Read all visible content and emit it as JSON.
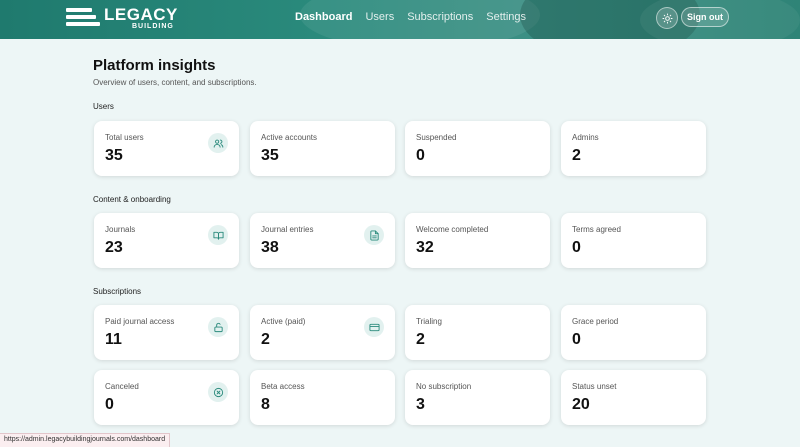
{
  "brand": {
    "name": "LEGACY",
    "sub": "BUILDING"
  },
  "nav": [
    {
      "label": "Dashboard",
      "active": true
    },
    {
      "label": "Users",
      "active": false
    },
    {
      "label": "Subscriptions",
      "active": false
    },
    {
      "label": "Settings",
      "active": false
    }
  ],
  "header": {
    "theme_icon": "sun-icon",
    "signout_label": "Sign out"
  },
  "page": {
    "title": "Platform insights",
    "subtitle": "Overview of users, content, and subscriptions."
  },
  "sections": {
    "users": {
      "label": "Users",
      "cards": [
        {
          "label": "Total users",
          "value": "35",
          "icon": "users-icon"
        },
        {
          "label": "Active accounts",
          "value": "35"
        },
        {
          "label": "Suspended",
          "value": "0"
        },
        {
          "label": "Admins",
          "value": "2"
        }
      ]
    },
    "content": {
      "label": "Content & onboarding",
      "cards": [
        {
          "label": "Journals",
          "value": "23",
          "icon": "book-open-icon"
        },
        {
          "label": "Journal entries",
          "value": "38",
          "icon": "document-icon"
        },
        {
          "label": "Welcome completed",
          "value": "32"
        },
        {
          "label": "Terms agreed",
          "value": "0"
        }
      ]
    },
    "subscriptions": {
      "label": "Subscriptions",
      "cards": [
        {
          "label": "Paid journal access",
          "value": "11",
          "icon": "lock-open-icon"
        },
        {
          "label": "Active (paid)",
          "value": "2",
          "icon": "credit-card-icon"
        },
        {
          "label": "Trialing",
          "value": "2"
        },
        {
          "label": "Grace period",
          "value": "0"
        },
        {
          "label": "Canceled",
          "value": "0",
          "icon": "x-circle-icon"
        },
        {
          "label": "Beta access",
          "value": "8"
        },
        {
          "label": "No subscription",
          "value": "3"
        },
        {
          "label": "Status unset",
          "value": "20"
        }
      ]
    }
  },
  "status_bar": {
    "url": "https://admin.legacybuildingjournals.com/dashboard"
  },
  "colors": {
    "header": "#1f7a6e",
    "background": "#edf6f6",
    "icon_bg": "#e2f1ef",
    "icon_stroke": "#2a8a7c"
  }
}
